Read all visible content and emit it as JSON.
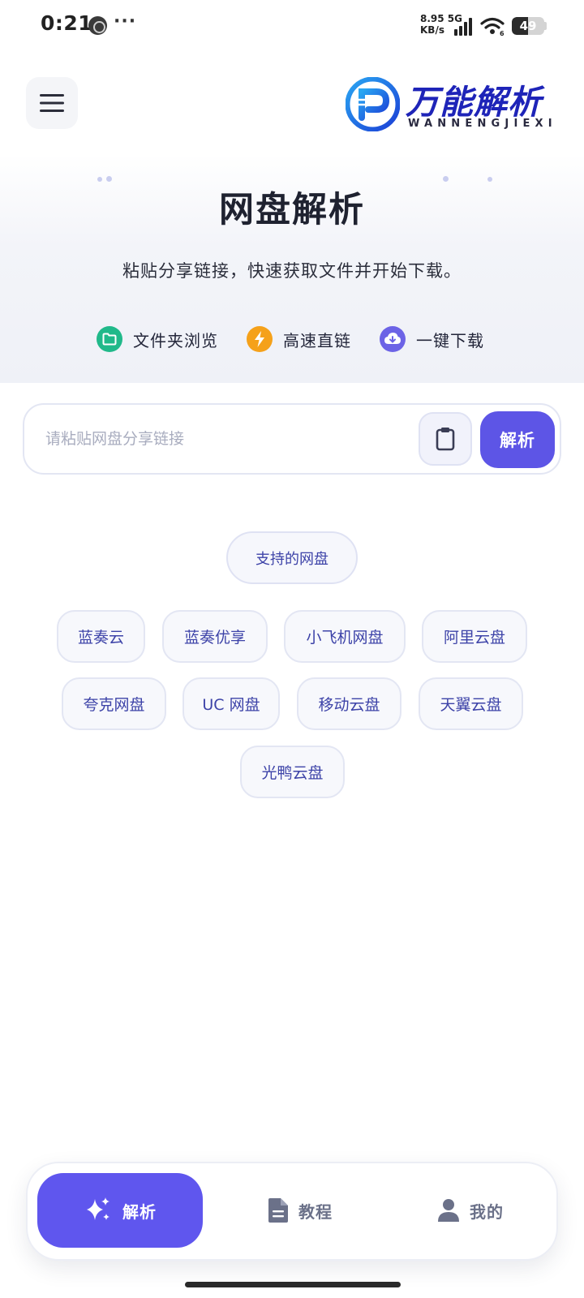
{
  "status_bar": {
    "time": "0:21",
    "more": "···",
    "speed_value": "8.95 5G",
    "speed_unit": "KB/s",
    "battery_level": 49,
    "battery_text": "49"
  },
  "header": {
    "logo_title": "万能解析",
    "logo_subtitle": "WANNENGJIEXI"
  },
  "hero": {
    "title": "网盘解析",
    "subtitle": "粘贴分享链接，快速获取文件并开始下载。",
    "features": [
      {
        "label": "文件夹浏览",
        "icon": "folder-icon",
        "color": "#20b98a"
      },
      {
        "label": "高速直链",
        "icon": "lightning-icon",
        "color": "#f5a11a"
      },
      {
        "label": "一键下载",
        "icon": "cloud-download-icon",
        "color": "#6c63e6"
      }
    ]
  },
  "search": {
    "placeholder": "请粘贴网盘分享链接",
    "value": "",
    "parse_label": "解析"
  },
  "supported": {
    "title": "支持的网盘",
    "disks": [
      "蓝奏云",
      "蓝奏优享",
      "小飞机网盘",
      "阿里云盘",
      "夸克网盘",
      "UC 网盘",
      "移动云盘",
      "天翼云盘",
      "光鸭云盘"
    ]
  },
  "bottom_nav": {
    "items": [
      {
        "label": "解析",
        "icon": "sparkle-icon",
        "active": true
      },
      {
        "label": "教程",
        "icon": "document-icon",
        "active": false
      },
      {
        "label": "我的",
        "icon": "user-icon",
        "active": false
      }
    ]
  },
  "colors": {
    "accent": "#5d55e6",
    "brand": "#1e24b8",
    "chip_text": "#3d43a8"
  }
}
